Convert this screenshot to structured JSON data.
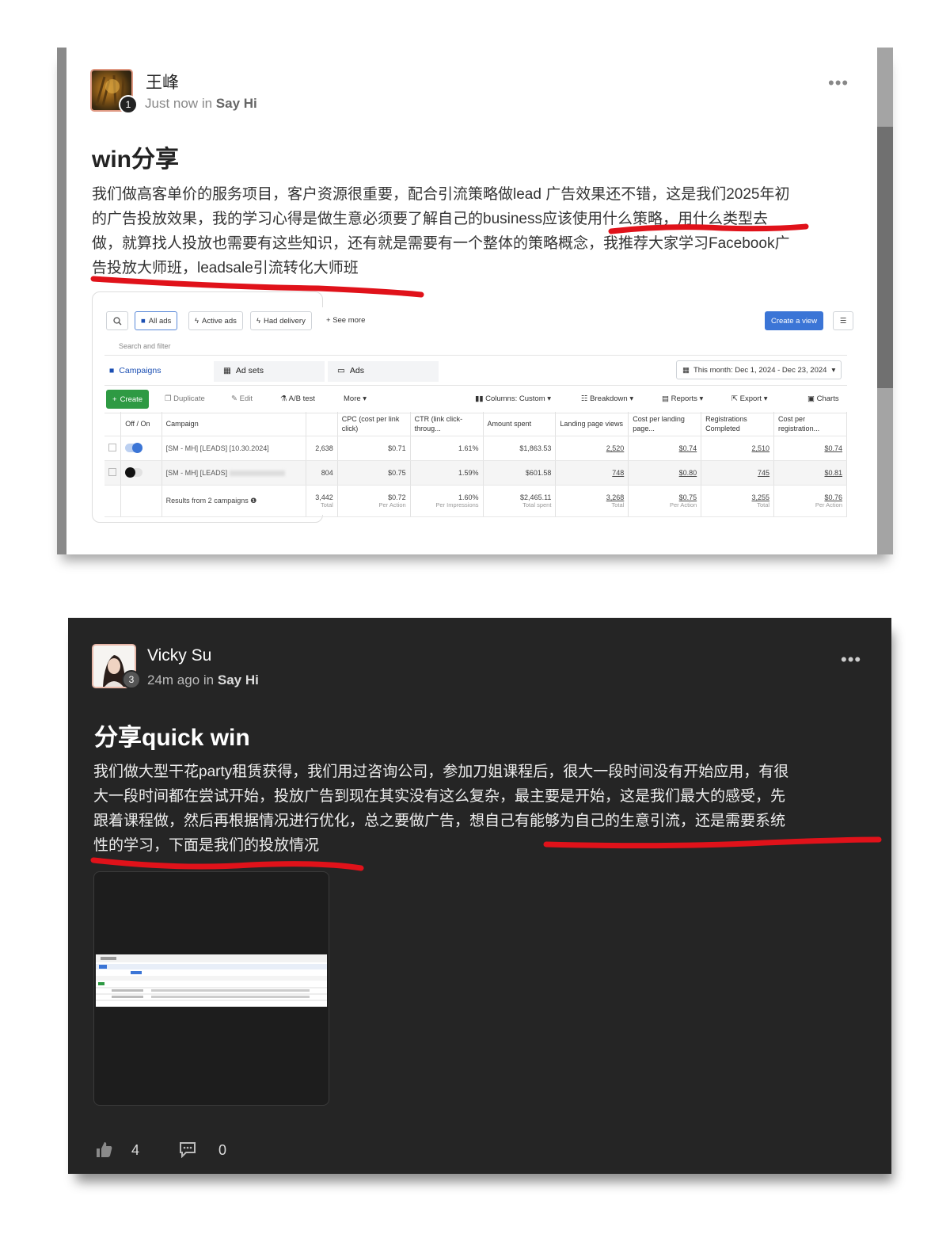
{
  "post1": {
    "author": "王峰",
    "badge": "1",
    "time": "Just now",
    "in_word": " in ",
    "group": "Say Hi",
    "menu": "•••",
    "title": "win分享",
    "body_lines": [
      "我们做高客单价的服务项目，客户资源很重要，配合引流策略做lead 广告效果还不错，这是我们2025年初",
      "的广告投放效果，我的学习心得是做生意必须要了解自己的business应该使用什么策略，用什么类型去",
      "做，就算找人投放也需要有这些知识，还有就是需要有一个整体的策略概念，我推荐大家学习Facebook广",
      "告投放大师班，leadsale引流转化大师班"
    ],
    "ads_manager": {
      "toolbar": {
        "all_ads": "All ads",
        "active_ads": "Active ads",
        "had_delivery": "Had delivery",
        "see_more": "See more",
        "create_view": "Create a view",
        "search_placeholder": "Search and filter"
      },
      "tabs": {
        "campaigns": "Campaigns",
        "ad_sets": "Ad sets",
        "ads": "Ads"
      },
      "date_range": "This month: Dec 1, 2024 - Dec 23, 2024",
      "actions": {
        "create": "Create",
        "duplicate": "Duplicate",
        "edit": "Edit",
        "ab_test": "A/B test",
        "more": "More",
        "columns": "Columns: Custom",
        "breakdown": "Breakdown",
        "reports": "Reports",
        "export": "Export",
        "charts": "Charts"
      },
      "columns": {
        "off_on": "Off / On",
        "campaign": "Campaign",
        "cpc": "CPC (cost per link click)",
        "ctr": "CTR (link click-throug...",
        "amount_spent": "Amount spent",
        "landing_views": "Landing page views",
        "cost_landing": "Cost per landing page...",
        "registrations": "Registrations Completed",
        "cost_registration": "Cost per registration..."
      },
      "rows": [
        {
          "name": "[SM - MH] [LEADS] [10.30.2024]",
          "results": "2,638",
          "cpc": "$0.71",
          "ctr": "1.61%",
          "spent": "$1,863.53",
          "views": "2,520",
          "cost_view": "$0.74",
          "regs": "2,510",
          "cost_reg": "$0.74",
          "toggle_on": true
        },
        {
          "name": "[SM - MH] [LEADS]",
          "results": "804",
          "cpc": "$0.75",
          "ctr": "1.59%",
          "spent": "$601.58",
          "views": "748",
          "cost_view": "$0.80",
          "regs": "745",
          "cost_reg": "$0.81",
          "toggle_on": false
        }
      ],
      "totals": {
        "label": "Results from 2 campaigns",
        "results": "3,442",
        "results_sub": "Total",
        "cpc": "$0.72",
        "cpc_sub": "Per Action",
        "ctr": "1.60%",
        "ctr_sub": "Per Impressions",
        "spent": "$2,465.11",
        "spent_sub": "Total spent",
        "views": "3,268",
        "views_sub": "Total",
        "cost_view": "$0.75",
        "cost_view_sub": "Per Action",
        "regs": "3,255",
        "regs_sub": "Total",
        "cost_reg": "$0.76",
        "cost_reg_sub": "Per Action"
      }
    }
  },
  "post2": {
    "author": "Vicky Su",
    "badge": "3",
    "time": "24m ago",
    "in_word": " in ",
    "group": "Say Hi",
    "menu": "•••",
    "title": "分享quick win",
    "body_lines": [
      "我们做大型干花party租赁获得，我们用过咨询公司，参加刀姐课程后，很大一段时间没有开始应用，有很",
      "大一段时间都在尝试开始，投放广告到现在其实没有这么复杂，最主要是开始，这是我们最大的感受，先",
      "跟着课程做，然后再根据情况进行优化，总之要做广告，想自己有能够为自己的生意引流，还是需要系统",
      "性的学习，下面是我们的投放情况"
    ],
    "likes": "4",
    "comments": "0",
    "colors": {
      "card_bg": "#252525",
      "underline": "#e0121a"
    }
  }
}
